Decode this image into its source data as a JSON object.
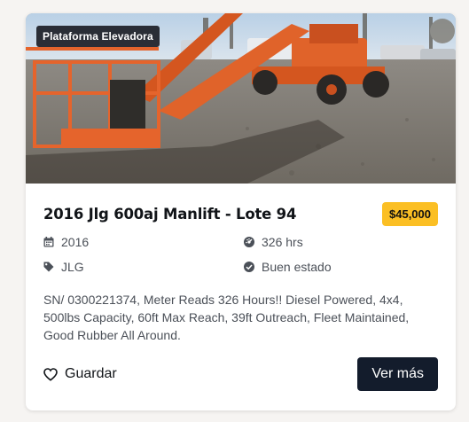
{
  "listing": {
    "category_badge": "Plataforma Elevadora",
    "title": "2016 Jlg 600aj Manlift - Lote 94",
    "price": "$45,000",
    "specs": {
      "year": "2016",
      "hours": "326 hrs",
      "brand": "JLG",
      "condition": "Buen estado"
    },
    "description": "SN/ 0300221374, Meter Reads 326 Hours!! Diesel Powered, 4x4, 500lbs Capacity, 60ft Max Reach, 39ft Outreach, Fleet Maintained, Good Rubber All Around.",
    "save_label": "Guardar",
    "more_label": "Ver más"
  },
  "icons": {
    "year": "calendar-icon",
    "hours": "gauge-icon",
    "brand": "tag-icon",
    "condition": "check-circle-icon",
    "save": "heart-icon"
  },
  "colors": {
    "price_badge": "#fbbf24",
    "primary_button": "#131c2c",
    "category_badge": "#14161c"
  }
}
